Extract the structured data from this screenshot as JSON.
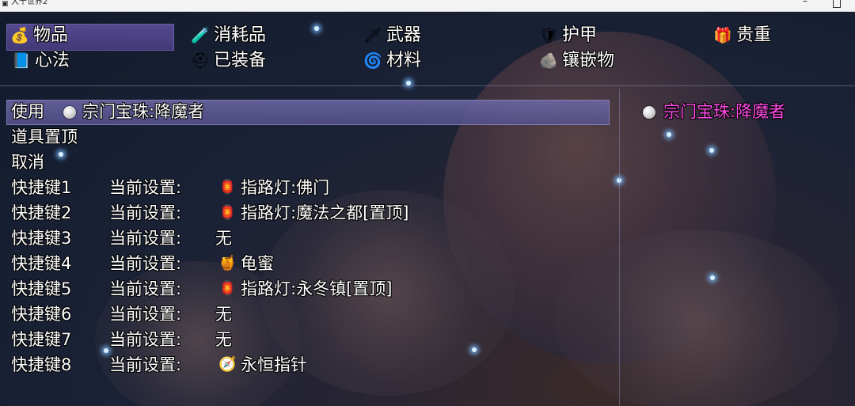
{
  "window": {
    "title": "大千世界2"
  },
  "categories": [
    {
      "label": "物品",
      "icon": "money-bag-icon",
      "glyph": "💰",
      "selected": true
    },
    {
      "label": "消耗品",
      "icon": "potion-icon",
      "glyph": "🧪",
      "selected": false
    },
    {
      "label": "武器",
      "icon": "sword-icon",
      "glyph": "🗡",
      "selected": false
    },
    {
      "label": "护甲",
      "icon": "armor-icon",
      "glyph": "🛡",
      "selected": false
    },
    {
      "label": "贵重",
      "icon": "treasure-chest-icon",
      "glyph": "🎁",
      "selected": false
    },
    {
      "label": "心法",
      "icon": "book-icon",
      "glyph": "📘",
      "selected": false
    },
    {
      "label": "已装备",
      "icon": "helmet-icon",
      "glyph": "⛑",
      "selected": false
    },
    {
      "label": "材料",
      "icon": "coil-icon",
      "glyph": "🌀",
      "selected": false
    },
    {
      "label": "镶嵌物",
      "icon": "ore-icon",
      "glyph": "🪨",
      "selected": false
    }
  ],
  "command_menu": {
    "use_label": "使用",
    "item_name": "宗门宝珠:降魔者",
    "pin_label": "道具置顶",
    "cancel_label": "取消",
    "current_setting_label": "当前设置:"
  },
  "shortcuts": [
    {
      "key": "快捷键1",
      "value": "指路灯:佛门",
      "icon": "lantern-icon",
      "glyph": "🏮"
    },
    {
      "key": "快捷键2",
      "value": "指路灯:魔法之都[置顶]",
      "icon": "lantern-icon",
      "glyph": "🏮"
    },
    {
      "key": "快捷键3",
      "value": "无",
      "icon": "",
      "glyph": ""
    },
    {
      "key": "快捷键4",
      "value": "龟蜜",
      "icon": "honey-pot-icon",
      "glyph": "🍯"
    },
    {
      "key": "快捷键5",
      "value": "指路灯:永冬镇[置顶]",
      "icon": "lantern-icon",
      "glyph": "🏮"
    },
    {
      "key": "快捷键6",
      "value": "无",
      "icon": "",
      "glyph": ""
    },
    {
      "key": "快捷键7",
      "value": "无",
      "icon": "",
      "glyph": ""
    },
    {
      "key": "快捷键8",
      "value": "永恒指针",
      "icon": "compass-icon",
      "glyph": "🧭"
    }
  ],
  "detail_panel": {
    "item_name": "宗门宝珠:降魔者",
    "icon": "pearl-icon",
    "name_color": "#ff4ce8"
  }
}
